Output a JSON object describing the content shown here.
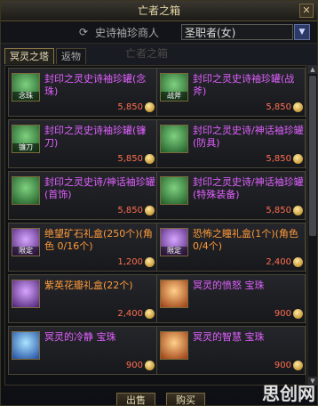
{
  "window": {
    "title": "亡者之箱",
    "close_glyph": "✕"
  },
  "shop": {
    "name": "史诗袖珍商人",
    "background_text": "亡者之箱"
  },
  "job_select": {
    "value": "圣职者(女)"
  },
  "tabs": [
    {
      "label": "冥灵之塔",
      "active": true
    },
    {
      "label": "返物",
      "active": false
    }
  ],
  "items": [
    {
      "name": "封印之灵史诗袖珍罐(念珠)",
      "tag": "念珠",
      "price": "5,850",
      "icon_color": "green",
      "name_color": "violet"
    },
    {
      "name": "封印之灵史诗袖珍罐(战斧)",
      "tag": "战斧",
      "price": "5,850",
      "icon_color": "green",
      "name_color": "violet"
    },
    {
      "name": "封印之灵史诗袖珍罐(镰刀)",
      "tag": "镰刀",
      "price": "5,850",
      "icon_color": "green",
      "name_color": "violet"
    },
    {
      "name": "封印之灵史诗/神话袖珍罐(防具)",
      "tag": "",
      "price": "5,850",
      "icon_color": "green",
      "name_color": "violet"
    },
    {
      "name": "封印之灵史诗/神话袖珍罐(首饰)",
      "tag": "",
      "price": "5,850",
      "icon_color": "green",
      "name_color": "violet"
    },
    {
      "name": "封印之灵史诗/神话袖珍罐(特殊装备)",
      "tag": "",
      "price": "5,850",
      "icon_color": "green",
      "name_color": "violet"
    },
    {
      "name": "绝望矿石礼盒(250个)(角色 0/16个)",
      "tag": "限定",
      "price": "1,200",
      "icon_color": "violet",
      "name_color": "orange"
    },
    {
      "name": "恐怖之瞳礼盒(1个)(角色 0/4个)",
      "tag": "限定",
      "price": "2,400",
      "icon_color": "violet",
      "name_color": "orange"
    },
    {
      "name": "紫英花瓣礼盒(22个)",
      "tag": "",
      "price": "2,400",
      "icon_color": "violet",
      "name_color": "orange"
    },
    {
      "name": "冥灵的愤怒 宝珠",
      "tag": "",
      "price": "900",
      "icon_color": "orange",
      "name_color": "violet"
    },
    {
      "name": "冥灵的冷静 宝珠",
      "tag": "",
      "price": "900",
      "icon_color": "blue",
      "name_color": "violet"
    },
    {
      "name": "冥灵的智慧 宝珠",
      "tag": "",
      "price": "900",
      "icon_color": "orange",
      "name_color": "violet"
    }
  ],
  "footer": {
    "buy_label": "出售",
    "sell_label": "购买",
    "site_mark": "思创网"
  },
  "colors": {
    "price": "#ff6e50",
    "accent": "#e6dcb8",
    "violet_name": "#e060ff",
    "orange_name": "#ff9b3a"
  }
}
